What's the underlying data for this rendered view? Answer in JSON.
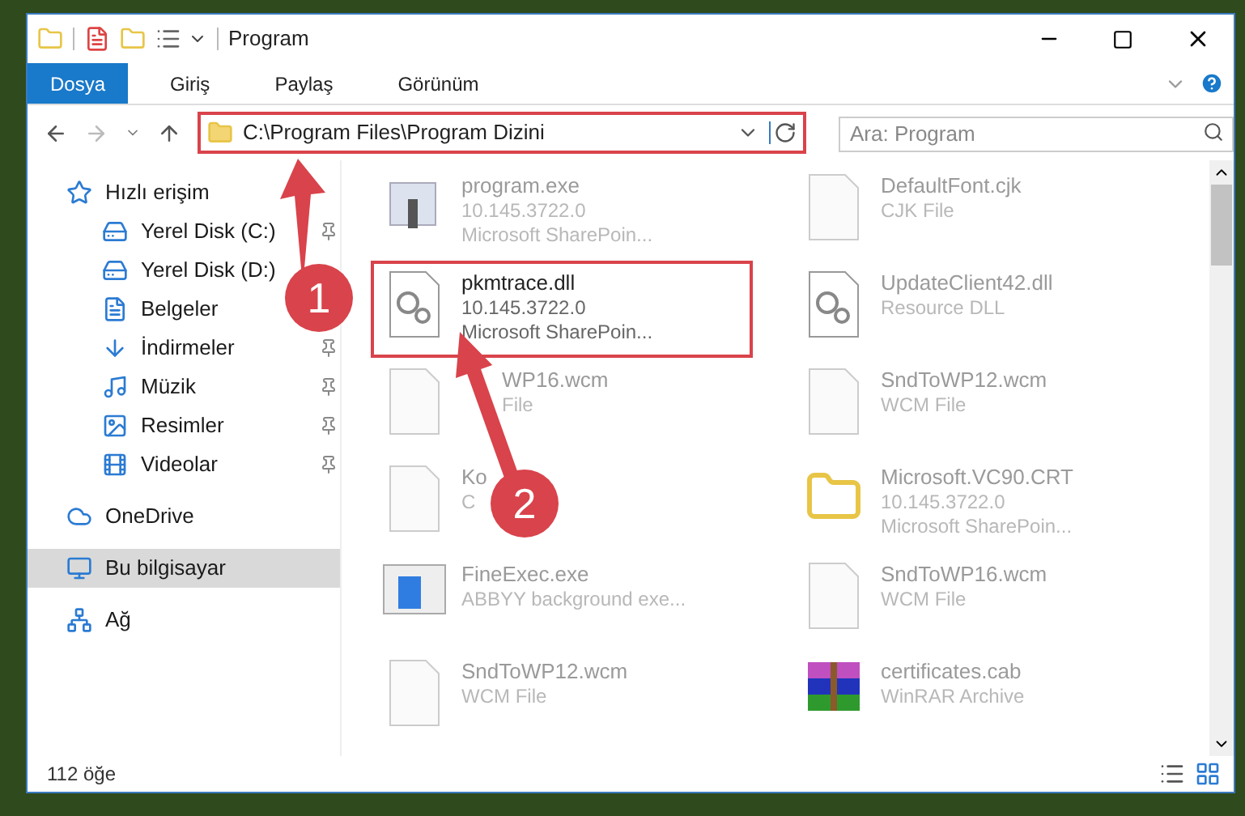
{
  "window": {
    "title": "Program"
  },
  "ribbon_tabs": [
    {
      "label": "Dosya",
      "selected": true
    },
    {
      "label": "Giriş",
      "selected": false
    },
    {
      "label": "Paylaş",
      "selected": false
    },
    {
      "label": "Görünüm",
      "selected": false
    }
  ],
  "address_bar": {
    "path": "C:\\Program Files\\Program Dizini",
    "annotated": true
  },
  "search": {
    "placeholder": "Ara: Program"
  },
  "sidebar": {
    "items": [
      {
        "label": "Hızlı erişim",
        "kind": "quick",
        "selected": false,
        "children": [
          {
            "label": "Yerel Disk (C:)",
            "kind": "drive",
            "selected": false,
            "pinned": true
          },
          {
            "label": "Yerel Disk (D:)",
            "kind": "drive",
            "selected": false
          },
          {
            "label": "Belgeler",
            "kind": "docs",
            "selected": false
          },
          {
            "label": "İndirmeler",
            "kind": "download",
            "selected": false,
            "pinned": true
          },
          {
            "label": "Müzik",
            "kind": "music",
            "selected": false,
            "pinned": true
          },
          {
            "label": "Resimler",
            "kind": "pictures",
            "selected": false,
            "pinned": true
          },
          {
            "label": "Videolar",
            "kind": "video",
            "selected": false,
            "pinned": true
          }
        ]
      },
      {
        "label": "OneDrive",
        "kind": "cloud",
        "selected": false
      },
      {
        "label": "Bu bilgisayar",
        "kind": "pc",
        "selected": true
      },
      {
        "label": "Ağ",
        "kind": "network",
        "selected": false
      }
    ]
  },
  "files": [
    {
      "name": "program.exe",
      "lines": [
        "10.145.3722.0",
        "Microsoft SharePoin..."
      ],
      "kind": "exe",
      "annotated": false
    },
    {
      "name": "DefaultFont.cjk",
      "lines": [
        "CJK File"
      ],
      "kind": "blank",
      "annotated": false
    },
    {
      "name": "pkmtrace.dll",
      "lines": [
        "10.145.3722.0",
        "Microsoft SharePoin..."
      ],
      "kind": "dll",
      "annotated": true
    },
    {
      "name": "UpdateClient42.dll",
      "lines": [
        "Resource DLL"
      ],
      "kind": "dll",
      "annotated": false
    },
    {
      "name": "WP16.wcm",
      "lines": [
        "File"
      ],
      "kind": "blank",
      "annotated": false,
      "covered": true
    },
    {
      "name": "SndToWP12.wcm",
      "lines": [
        "WCM File"
      ],
      "kind": "blank",
      "annotated": false
    },
    {
      "name": "Ko",
      "lines": [
        "C"
      ],
      "kind": "blank",
      "annotated": false
    },
    {
      "name": "Microsoft.VC90.CRT",
      "lines": [
        "10.145.3722.0",
        "Microsoft SharePoin..."
      ],
      "kind": "folder",
      "annotated": false
    },
    {
      "name": "FineExec.exe",
      "lines": [
        "ABBYY background exe..."
      ],
      "kind": "app",
      "annotated": false
    },
    {
      "name": "SndToWP16.wcm",
      "lines": [
        "WCM File"
      ],
      "kind": "blank",
      "annotated": false
    },
    {
      "name": "SndToWP12.wcm",
      "lines": [
        "WCM File"
      ],
      "kind": "blank",
      "annotated": false
    },
    {
      "name": "certificates.cab",
      "lines": [
        "WinRAR Archive"
      ],
      "kind": "archive",
      "annotated": false
    }
  ],
  "status_bar": {
    "count": "112 öğe"
  },
  "annotations": [
    {
      "label": "1"
    },
    {
      "label": "2"
    }
  ]
}
